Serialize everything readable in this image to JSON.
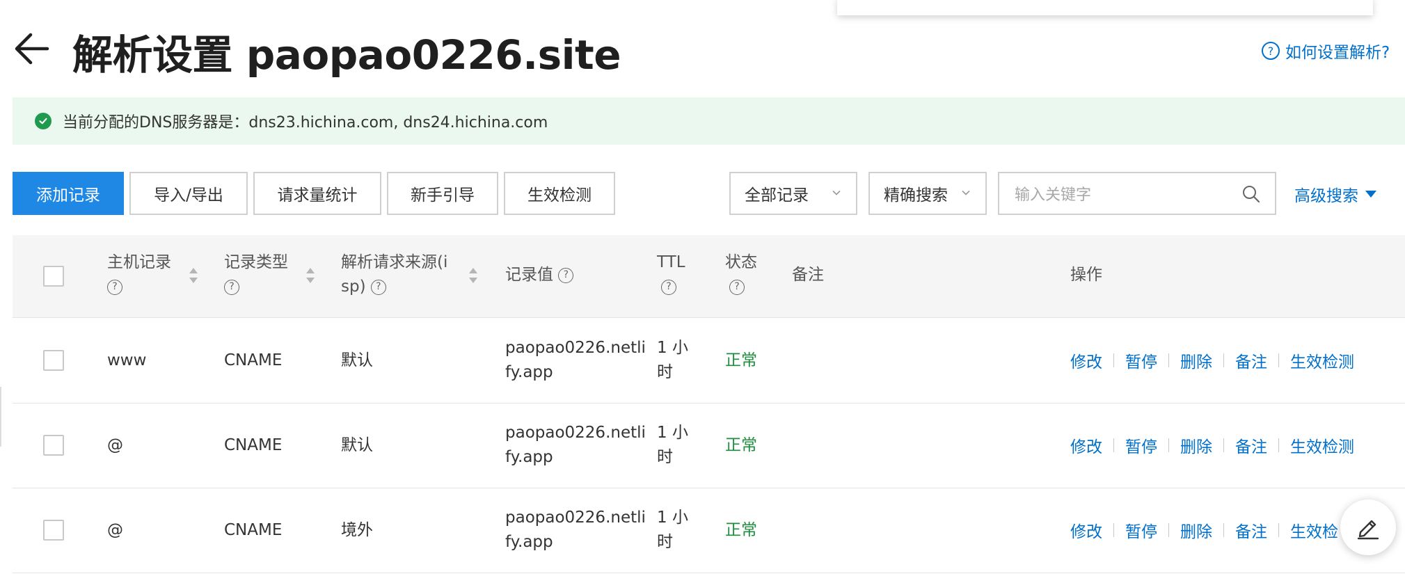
{
  "header": {
    "title": "解析设置 paopao0226.site",
    "help_link": "如何设置解析?"
  },
  "banner": {
    "text": "当前分配的DNS服务器是：dns23.hichina.com, dns24.hichina.com"
  },
  "toolbar": {
    "add_record": "添加记录",
    "import_export": "导入/导出",
    "request_stats": "请求量统计",
    "beginner_guide": "新手引导",
    "effect_check": "生效检测",
    "record_filter": "全部记录",
    "search_mode": "精确搜索",
    "search_placeholder": "输入关键字",
    "advanced_search": "高级搜索"
  },
  "table": {
    "headers": {
      "host_l1": "主机记录",
      "type_l1": "记录类型",
      "source_l1": "解析请求来源(i",
      "source_l2": "sp)",
      "value": "记录值",
      "ttl": "TTL",
      "status": "状态",
      "remark": "备注",
      "ops": "操作"
    },
    "rows": [
      {
        "host": "www",
        "type": "CNAME",
        "source": "默认",
        "value_l1": "paopao0226.netli",
        "value_l2": "fy.app",
        "ttl_l1": "1 小",
        "ttl_l2": "时",
        "status": "正常",
        "ops": [
          "修改",
          "暂停",
          "删除",
          "备注",
          "生效检测"
        ]
      },
      {
        "host": "@",
        "type": "CNAME",
        "source": "默认",
        "value_l1": "paopao0226.netli",
        "value_l2": "fy.app",
        "ttl_l1": "1 小",
        "ttl_l2": "时",
        "status": "正常",
        "ops": [
          "修改",
          "暂停",
          "删除",
          "备注",
          "生效检测"
        ]
      },
      {
        "host": "@",
        "type": "CNAME",
        "source": "境外",
        "value_l1": "paopao0226.netli",
        "value_l2": "fy.app",
        "ttl_l1": "1 小",
        "ttl_l2": "时",
        "status": "正常",
        "ops": [
          "修改",
          "暂停",
          "删除",
          "备注",
          "生效检"
        ]
      }
    ]
  },
  "colors": {
    "primary": "#1f88e5",
    "link": "#0070cc",
    "success": "#1e8e3e",
    "banner_bg": "#eaf8ef"
  },
  "icons": [
    "arrow-left-icon",
    "question-circle-icon",
    "check-circle-icon",
    "chevron-down-icon",
    "search-icon",
    "caret-down-icon",
    "sort-icon",
    "edit-pen-icon"
  ]
}
